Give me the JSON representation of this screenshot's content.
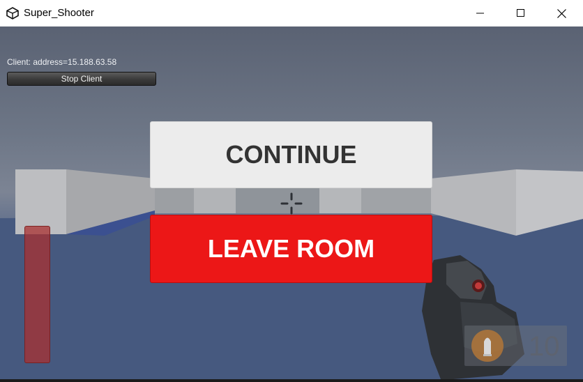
{
  "window": {
    "title": "Super_Shooter",
    "app_icon": "unity-icon",
    "controls": [
      "minimize-icon",
      "maximize-icon",
      "close-icon"
    ]
  },
  "network_hud": {
    "client_status": "Client: address=15.188.63.58",
    "stop_client_label": "Stop Client"
  },
  "pause_menu": {
    "continue_label": "CONTINUE",
    "leave_room_label": "LEAVE ROOM",
    "leave_room_color": "#EC1717"
  },
  "hud": {
    "crosshair_icon": "crosshair-icon",
    "health_color": "#AA3030",
    "ammo_icon": "bullet-icon",
    "ammo_count": "10"
  }
}
